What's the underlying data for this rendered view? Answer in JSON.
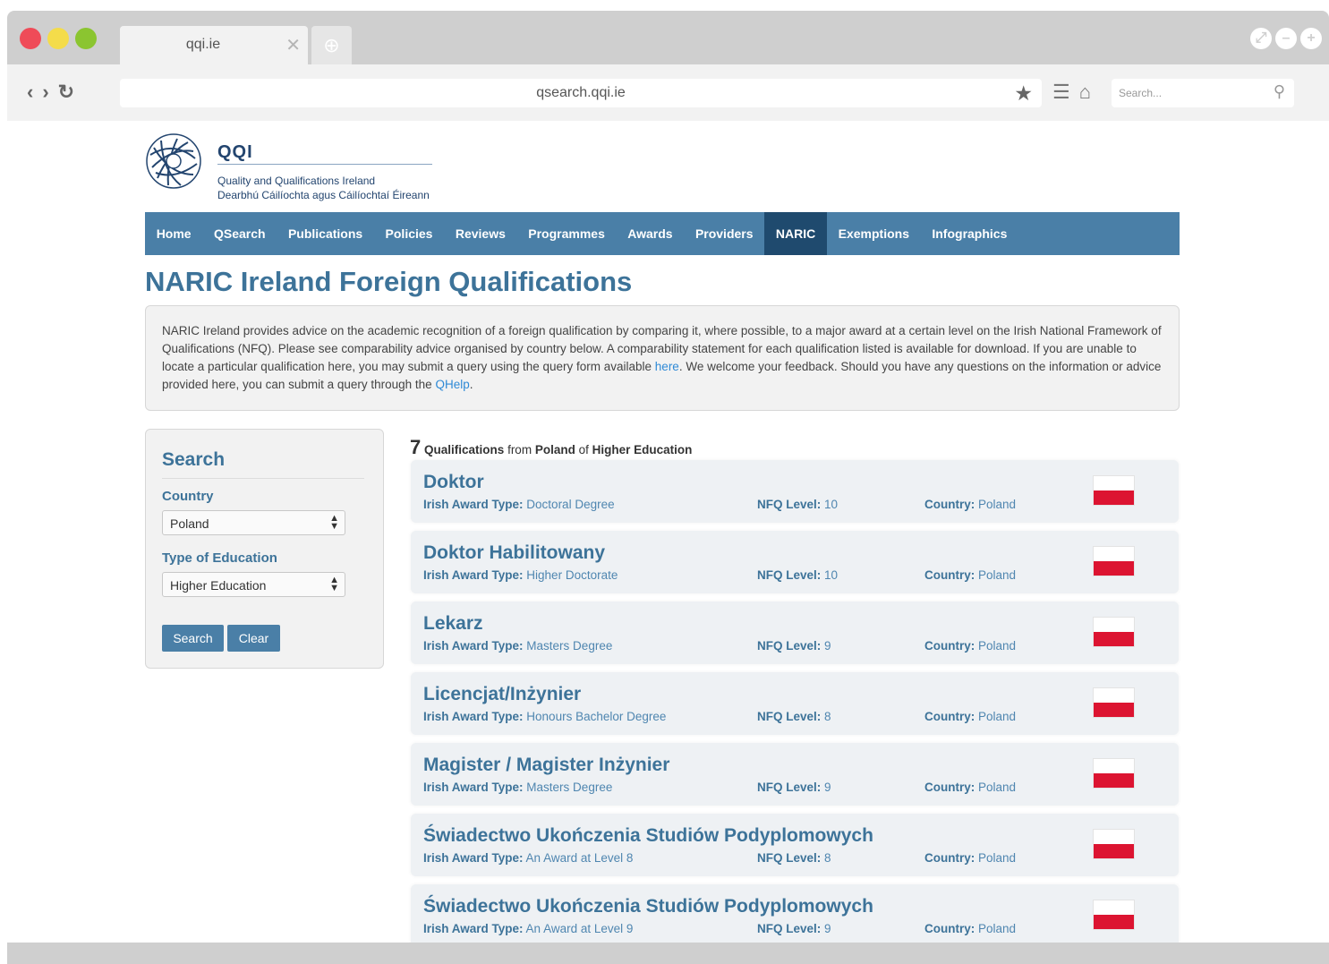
{
  "browser": {
    "tab_title": "qqi.ie",
    "url": "qsearch.qqi.ie",
    "search_placeholder": "Search..."
  },
  "site": {
    "logo_name": "QQI",
    "logo_sub1": "Quality and Qualifications Ireland",
    "logo_sub2": "Dearbhú Cáilíochta agus Cáilíochtaí Éireann"
  },
  "nav": {
    "items": [
      "Home",
      "QSearch",
      "Publications",
      "Policies",
      "Reviews",
      "Programmes",
      "Awards",
      "Providers",
      "NARIC",
      "Exemptions",
      "Infographics"
    ],
    "active": "NARIC"
  },
  "page": {
    "title": "NARIC Ireland Foreign Qualifications",
    "intro_part1": "NARIC Ireland provides advice on the academic recognition of a foreign qualification by comparing it, where possible, to a major award at a certain level on the Irish National Framework of Qualifications (NFQ). Please see comparability advice organised by country below. A comparability statement for each qualification listed is available for download. If you are unable to locate a particular qualification here, you may submit a query using the query form available ",
    "intro_link1": "here",
    "intro_part2": ". We welcome your feedback. Should you have any questions on the information or advice provided here, you can submit a query through the ",
    "intro_link2": "QHelp",
    "intro_part3": "."
  },
  "search_panel": {
    "title": "Search",
    "country_label": "Country",
    "country_value": "Poland",
    "education_label": "Type of Education",
    "education_value": "Higher Education",
    "search_button": "Search",
    "clear_button": "Clear"
  },
  "results": {
    "count": "7",
    "text_qualifications": "Qualifications",
    "text_from": "from",
    "country": "Poland",
    "text_of": "of",
    "education": "Higher Education",
    "award_type_label": "Irish Award Type:",
    "nfq_label": "NFQ Level:",
    "country_label": "Country:",
    "items": [
      {
        "title": "Doktor",
        "award_type": "Doctoral Degree",
        "nfq_level": "10",
        "country": "Poland"
      },
      {
        "title": "Doktor Habilitowany",
        "award_type": "Higher Doctorate",
        "nfq_level": "10",
        "country": "Poland"
      },
      {
        "title": "Lekarz",
        "award_type": "Masters Degree",
        "nfq_level": "9",
        "country": "Poland"
      },
      {
        "title": "Licencjat/Inżynier",
        "award_type": "Honours Bachelor Degree",
        "nfq_level": "8",
        "country": "Poland"
      },
      {
        "title": "Magister / Magister Inżynier",
        "award_type": "Masters Degree",
        "nfq_level": "9",
        "country": "Poland"
      },
      {
        "title": "Świadectwo Ukończenia Studiów Podyplomowych",
        "award_type": "An Award at Level 8",
        "nfq_level": "8",
        "country": "Poland"
      },
      {
        "title": "Świadectwo Ukończenia Studiów Podyplomowych",
        "award_type": "An Award at Level 9",
        "nfq_level": "9",
        "country": "Poland"
      }
    ]
  },
  "colors": {
    "brand_blue": "#4a7fa7",
    "nav_active": "#1f4a6e",
    "title_blue": "#3d7399",
    "link_blue": "#2f8ad6",
    "flag_red": "#dc1431"
  }
}
